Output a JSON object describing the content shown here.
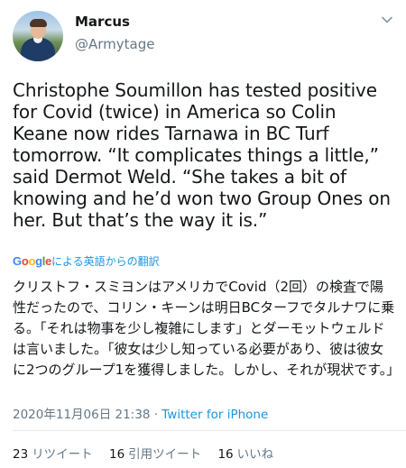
{
  "user": {
    "display_name": "Marcus",
    "handle": "@Armytage"
  },
  "tweet": {
    "text": "Christophe Soumillon has tested positive for Covid (twice) in America so Colin Keane now rides Tarnawa in BC Turf tomorrow. “It complicates things a little,” said Dermot Weld. “She takes a bit of knowing and he’d won two Group Ones on her. But that’s the way it is.”"
  },
  "translation": {
    "google_letters": [
      "G",
      "o",
      "o",
      "g",
      "l",
      "e"
    ],
    "label": "による英語からの翻訳",
    "text": "クリストフ・スミヨンはアメリカでCovid（2回）の検査で陽性だったので、コリン・キーンは明日BCターフでタルナワに乗る。「それは物事を少し複雑にします」とダーモットウェルドは言いました。「彼女は少し知っている必要があり、彼は彼女に2つのグループ1を獲得しました。しかし、それが現状です。」"
  },
  "meta": {
    "timestamp": "2020年11月06日 21:38",
    "separator": " · ",
    "source": "Twitter for iPhone"
  },
  "stats": {
    "retweets_count": "23",
    "retweets_label": "リツイート",
    "quotes_count": "16",
    "quotes_label": "引用ツイート",
    "likes_count": "16",
    "likes_label": "いいね"
  },
  "icons": {
    "menu": "chevron-down-icon"
  },
  "colors": {
    "text": "#14171a",
    "secondary": "#657786",
    "link": "#1b95e0"
  }
}
